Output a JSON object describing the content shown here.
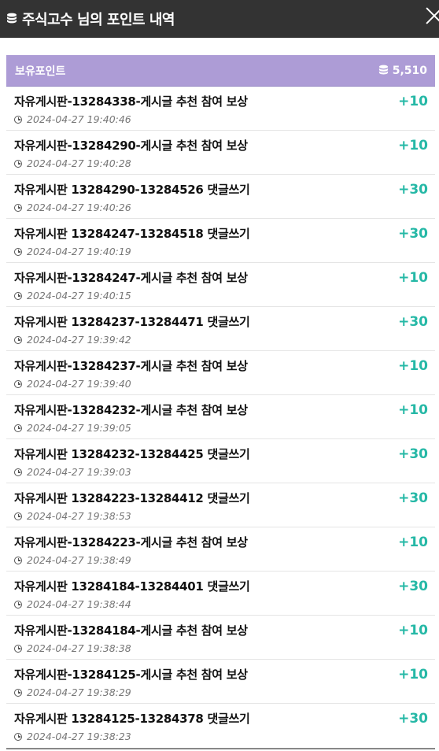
{
  "header": {
    "title": "주식고수 님의 포인트 내역"
  },
  "summary": {
    "label": "보유포인트",
    "total": "5,510"
  },
  "colors": {
    "topbar": "#333333",
    "summary_bar": "#ad9cd6",
    "points": "#25b8a6"
  },
  "entries": [
    {
      "content": "자유게시판-13284338-게시글 추천 참여 보상",
      "datetime": "2024-04-27 19:40:46",
      "points": "+10"
    },
    {
      "content": "자유게시판-13284290-게시글 추천 참여 보상",
      "datetime": "2024-04-27 19:40:28",
      "points": "+10"
    },
    {
      "content": "자유게시판 13284290-13284526 댓글쓰기",
      "datetime": "2024-04-27 19:40:26",
      "points": "+30"
    },
    {
      "content": "자유게시판 13284247-13284518 댓글쓰기",
      "datetime": "2024-04-27 19:40:19",
      "points": "+30"
    },
    {
      "content": "자유게시판-13284247-게시글 추천 참여 보상",
      "datetime": "2024-04-27 19:40:15",
      "points": "+10"
    },
    {
      "content": "자유게시판 13284237-13284471 댓글쓰기",
      "datetime": "2024-04-27 19:39:42",
      "points": "+30"
    },
    {
      "content": "자유게시판-13284237-게시글 추천 참여 보상",
      "datetime": "2024-04-27 19:39:40",
      "points": "+10"
    },
    {
      "content": "자유게시판-13284232-게시글 추천 참여 보상",
      "datetime": "2024-04-27 19:39:05",
      "points": "+10"
    },
    {
      "content": "자유게시판 13284232-13284425 댓글쓰기",
      "datetime": "2024-04-27 19:39:03",
      "points": "+30"
    },
    {
      "content": "자유게시판 13284223-13284412 댓글쓰기",
      "datetime": "2024-04-27 19:38:53",
      "points": "+30"
    },
    {
      "content": "자유게시판-13284223-게시글 추천 참여 보상",
      "datetime": "2024-04-27 19:38:49",
      "points": "+10"
    },
    {
      "content": "자유게시판 13284184-13284401 댓글쓰기",
      "datetime": "2024-04-27 19:38:44",
      "points": "+30"
    },
    {
      "content": "자유게시판-13284184-게시글 추천 참여 보상",
      "datetime": "2024-04-27 19:38:38",
      "points": "+10"
    },
    {
      "content": "자유게시판-13284125-게시글 추천 참여 보상",
      "datetime": "2024-04-27 19:38:29",
      "points": "+10"
    },
    {
      "content": "자유게시판 13284125-13284378 댓글쓰기",
      "datetime": "2024-04-27 19:38:23",
      "points": "+30"
    }
  ]
}
